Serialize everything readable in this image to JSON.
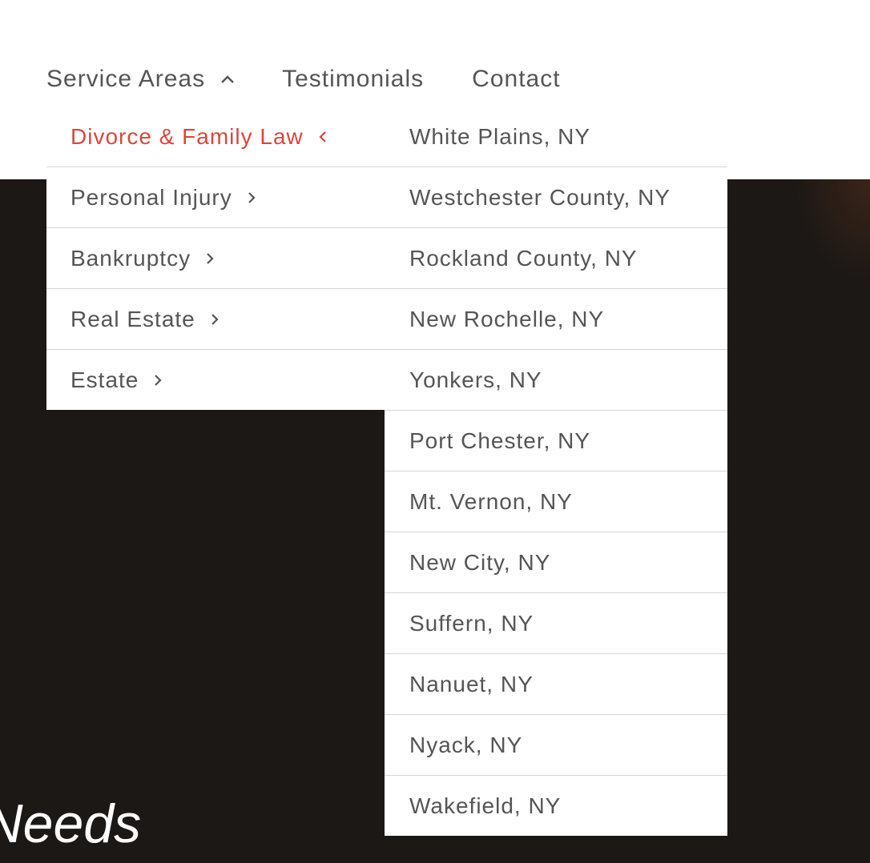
{
  "nav": {
    "items": [
      {
        "label": "Service Areas",
        "open": true
      },
      {
        "label": "Testimonials"
      },
      {
        "label": "Contact"
      }
    ]
  },
  "practice_menu": {
    "items": [
      {
        "label": "Divorce & Family Law",
        "active": true
      },
      {
        "label": "Personal Injury"
      },
      {
        "label": "Bankruptcy"
      },
      {
        "label": "Real Estate"
      },
      {
        "label": "Estate"
      }
    ]
  },
  "locations_menu": {
    "items": [
      {
        "label": "White Plains, NY"
      },
      {
        "label": "Westchester County, NY"
      },
      {
        "label": "Rockland County, NY"
      },
      {
        "label": "New Rochelle, NY"
      },
      {
        "label": "Yonkers, NY"
      },
      {
        "label": "Port Chester, NY"
      },
      {
        "label": "Mt. Vernon, NY"
      },
      {
        "label": "New City, NY"
      },
      {
        "label": "Suffern, NY"
      },
      {
        "label": "Nanuet, NY"
      },
      {
        "label": "Nyack, NY"
      },
      {
        "label": "Wakefield, NY"
      }
    ]
  },
  "hero": {
    "text": "r Needs"
  },
  "colors": {
    "accent": "#d9473e",
    "text": "#555555",
    "divider": "#d6d6d6",
    "hero_bg": "#1c1816"
  },
  "icons": {
    "nav_open": "chevron-up-icon",
    "submenu": "chevron-right-icon",
    "submenu_open": "chevron-left-icon"
  }
}
